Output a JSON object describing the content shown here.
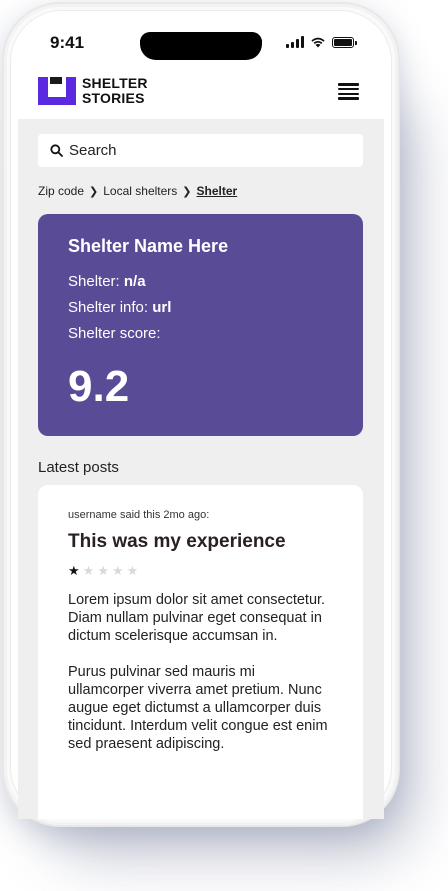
{
  "status_bar": {
    "time": "9:41"
  },
  "brand": {
    "line1": "SHELTER",
    "line2": "STORIES",
    "accent": "#5b29e0"
  },
  "search": {
    "placeholder": "Search"
  },
  "breadcrumb": {
    "items": [
      "Zip code",
      "Local shelters",
      "Shelter"
    ]
  },
  "shelter": {
    "name": "Shelter Name Here",
    "shelter_label": "Shelter: ",
    "shelter_value": "n/a",
    "info_label": "Shelter info: ",
    "info_value": "url",
    "score_label": "Shelter score:",
    "score_value": "9.2",
    "card_color": "#5a4b96"
  },
  "latest": {
    "title": "Latest posts"
  },
  "post": {
    "meta": "username said this 2mo ago:",
    "title": "This was my experience",
    "rating": 1,
    "rating_max": 5,
    "paragraphs": [
      "Lorem ipsum dolor sit amet consectetur. Diam nullam pulvinar eget consequat in dictum scelerisque accumsan in.",
      "Purus pulvinar sed mauris mi ullamcorper viverra amet pretium. Nunc augue eget dictumst a ullamcorper duis tincidunt. Interdum velit congue est enim sed praesent adipiscing."
    ]
  }
}
